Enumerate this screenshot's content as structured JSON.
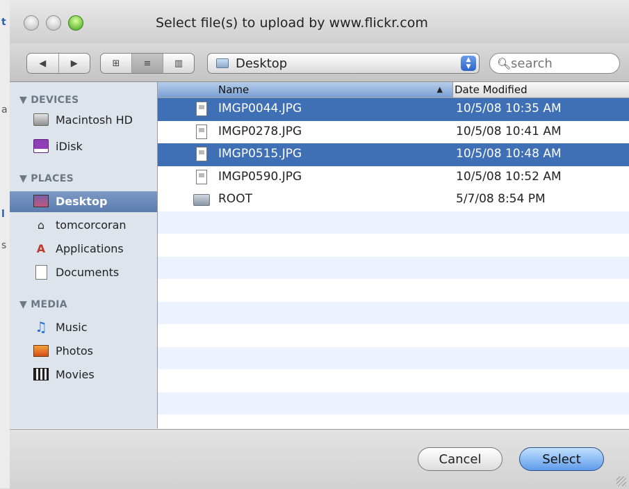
{
  "window": {
    "title": "Select file(s) to upload by www.flickr.com"
  },
  "toolbar": {
    "nav_back": "◀",
    "nav_forward": "▶",
    "view_icons": "⊞",
    "view_list": "≡",
    "view_columns": "▥",
    "location": "Desktop",
    "search_placeholder": "search"
  },
  "sidebar": {
    "devices_header": "▼ DEVICES",
    "places_header": "▼ PLACES",
    "media_header": "▼ MEDIA",
    "devices": [
      {
        "label": "Macintosh HD",
        "icon": "hard-drive-icon"
      },
      {
        "label": "iDisk",
        "icon": "idisk-icon"
      }
    ],
    "places": [
      {
        "label": "Desktop",
        "icon": "desktop-icon",
        "selected": true
      },
      {
        "label": "tomcorcoran",
        "icon": "home-icon"
      },
      {
        "label": "Applications",
        "icon": "applications-icon"
      },
      {
        "label": "Documents",
        "icon": "documents-icon"
      }
    ],
    "media": [
      {
        "label": "Music",
        "icon": "music-icon"
      },
      {
        "label": "Photos",
        "icon": "photos-icon"
      },
      {
        "label": "Movies",
        "icon": "movies-icon"
      }
    ]
  },
  "file_list": {
    "columns": {
      "name": "Name",
      "date": "Date Modified",
      "sort_indicator": "▲"
    },
    "rows": [
      {
        "name": "IMGP0044.JPG",
        "date": "10/5/08 10:35 AM",
        "selected": true,
        "icon": "jpeg-file-icon"
      },
      {
        "name": "IMGP0278.JPG",
        "date": "10/5/08 10:41 AM",
        "selected": false,
        "icon": "jpeg-file-icon"
      },
      {
        "name": "IMGP0515.JPG",
        "date": "10/5/08 10:48 AM",
        "selected": true,
        "icon": "jpeg-file-icon"
      },
      {
        "name": "IMGP0590.JPG",
        "date": "10/5/08 10:52 AM",
        "selected": false,
        "icon": "jpeg-file-icon"
      },
      {
        "name": "ROOT",
        "date": "5/7/08 8:54 PM",
        "selected": false,
        "icon": "folder-icon"
      }
    ]
  },
  "buttons": {
    "cancel": "Cancel",
    "select": "Select"
  },
  "colors": {
    "selection": "#3f6fb5",
    "sidebar_bg": "#dde4eb",
    "default_button": "#5f9bea"
  }
}
